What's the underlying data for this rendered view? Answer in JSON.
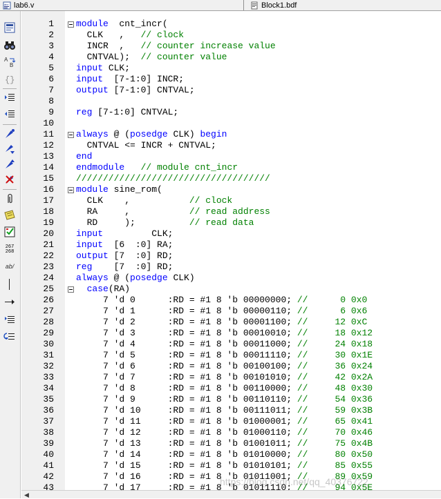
{
  "tabs": [
    {
      "label": "lab6.v",
      "icon": "verilog-file-icon"
    },
    {
      "label": "Block1.bdf",
      "icon": "block-diagram-file-icon"
    }
  ],
  "toolbar": [
    {
      "name": "insert-template-icon"
    },
    {
      "name": "find-binoculars-icon"
    },
    {
      "name": "find-replace-icon"
    },
    {
      "name": "braces-icon"
    },
    {
      "name": "indent-icon"
    },
    {
      "name": "unindent-icon"
    },
    {
      "name": "toggle-bookmark-icon"
    },
    {
      "name": "next-bookmark-icon"
    },
    {
      "name": "previous-bookmark-icon"
    },
    {
      "name": "clear-bookmarks-icon"
    },
    {
      "name": "paperclip-icon"
    },
    {
      "name": "comment-block-icon"
    },
    {
      "name": "check-syntax-icon"
    },
    {
      "name": "line-numbers-icon",
      "text": "267\n268"
    },
    {
      "name": "text-format-icon",
      "text": "ab/"
    },
    {
      "name": "cursor-line-icon"
    },
    {
      "name": "arrow-right-icon"
    },
    {
      "name": "list-indent-icon"
    },
    {
      "name": "undo-wrap-icon"
    }
  ],
  "lines": [
    {
      "n": "1",
      "fold": true,
      "seg": [
        [
          "kw",
          "module"
        ],
        [
          "",
          "  cnt_incr("
        ]
      ]
    },
    {
      "n": "2",
      "fold": false,
      "seg": [
        [
          "",
          "  CLK   ,   "
        ],
        [
          "cm",
          "// clock"
        ]
      ]
    },
    {
      "n": "3",
      "fold": false,
      "seg": [
        [
          "",
          "  INCR  ,   "
        ],
        [
          "cm",
          "// counter increase value"
        ]
      ]
    },
    {
      "n": "4",
      "fold": false,
      "seg": [
        [
          "",
          "  CNTVAL);  "
        ],
        [
          "cm",
          "// counter value"
        ]
      ]
    },
    {
      "n": "5",
      "fold": false,
      "seg": [
        [
          "kw",
          "input"
        ],
        [
          "",
          " CLK;"
        ]
      ]
    },
    {
      "n": "6",
      "fold": false,
      "seg": [
        [
          "kw",
          "input"
        ],
        [
          "",
          "  [7-1:0] INCR;"
        ]
      ]
    },
    {
      "n": "7",
      "fold": false,
      "seg": [
        [
          "kw",
          "output"
        ],
        [
          "",
          " [7-1:0] CNTVAL;"
        ]
      ]
    },
    {
      "n": "8",
      "fold": false,
      "seg": [
        [
          "",
          ""
        ]
      ]
    },
    {
      "n": "9",
      "fold": false,
      "seg": [
        [
          "kw",
          "reg"
        ],
        [
          "",
          " [7-1:0] CNTVAL;"
        ]
      ]
    },
    {
      "n": "10",
      "fold": false,
      "seg": [
        [
          "",
          ""
        ]
      ]
    },
    {
      "n": "11",
      "fold": true,
      "seg": [
        [
          "kw",
          "always"
        ],
        [
          "",
          " @ ("
        ],
        [
          "kw",
          "posedge"
        ],
        [
          "",
          " CLK) "
        ],
        [
          "kw",
          "begin"
        ]
      ]
    },
    {
      "n": "12",
      "fold": false,
      "seg": [
        [
          "",
          "  CNTVAL <= INCR + CNTVAL;"
        ]
      ]
    },
    {
      "n": "13",
      "fold": false,
      "seg": [
        [
          "kw",
          "end"
        ]
      ]
    },
    {
      "n": "14",
      "fold": false,
      "seg": [
        [
          "kw",
          "endmodule"
        ],
        [
          "",
          "   "
        ],
        [
          "cm",
          "// module cnt_incr"
        ]
      ]
    },
    {
      "n": "15",
      "fold": false,
      "seg": [
        [
          "cm",
          "////////////////////////////////////"
        ]
      ]
    },
    {
      "n": "16",
      "fold": true,
      "seg": [
        [
          "kw",
          "module"
        ],
        [
          "",
          " sine_rom("
        ]
      ]
    },
    {
      "n": "17",
      "fold": false,
      "seg": [
        [
          "",
          "  CLK    ,           "
        ],
        [
          "cm",
          "// clock"
        ]
      ]
    },
    {
      "n": "18",
      "fold": false,
      "seg": [
        [
          "",
          "  RA     ,           "
        ],
        [
          "cm",
          "// read address"
        ]
      ]
    },
    {
      "n": "19",
      "fold": false,
      "seg": [
        [
          "",
          "  RD     );          "
        ],
        [
          "cm",
          "// read data"
        ]
      ]
    },
    {
      "n": "20",
      "fold": false,
      "seg": [
        [
          "kw",
          "input"
        ],
        [
          "",
          "         CLK;"
        ]
      ]
    },
    {
      "n": "21",
      "fold": false,
      "seg": [
        [
          "kw",
          "input"
        ],
        [
          "",
          "  [6  :0] RA;"
        ]
      ]
    },
    {
      "n": "22",
      "fold": false,
      "seg": [
        [
          "kw",
          "output"
        ],
        [
          "",
          " [7  :0] RD;"
        ]
      ]
    },
    {
      "n": "23",
      "fold": false,
      "seg": [
        [
          "kw",
          "reg"
        ],
        [
          "",
          "    [7  :0] RD;"
        ]
      ]
    },
    {
      "n": "24",
      "fold": false,
      "seg": [
        [
          "kw",
          "always"
        ],
        [
          "",
          " @ ("
        ],
        [
          "kw",
          "posedge"
        ],
        [
          "",
          " CLK)"
        ]
      ]
    },
    {
      "n": "25",
      "fold": true,
      "seg": [
        [
          "",
          "  "
        ],
        [
          "kw",
          "case"
        ],
        [
          "",
          "(RA)"
        ]
      ]
    },
    {
      "n": "26",
      "fold": false,
      "seg": [
        [
          "",
          "     7 'd 0      :RD = #1 8 'b 00000000; "
        ],
        [
          "cm",
          "//      0 0x0"
        ]
      ]
    },
    {
      "n": "27",
      "fold": false,
      "seg": [
        [
          "",
          "     7 'd 1      :RD = #1 8 'b 00000110; "
        ],
        [
          "cm",
          "//      6 0x6"
        ]
      ]
    },
    {
      "n": "28",
      "fold": false,
      "seg": [
        [
          "",
          "     7 'd 2      :RD = #1 8 'b 00001100; "
        ],
        [
          "cm",
          "//     12 0xC"
        ]
      ]
    },
    {
      "n": "29",
      "fold": false,
      "seg": [
        [
          "",
          "     7 'd 3      :RD = #1 8 'b 00010010; "
        ],
        [
          "cm",
          "//     18 0x12"
        ]
      ]
    },
    {
      "n": "30",
      "fold": false,
      "seg": [
        [
          "",
          "     7 'd 4      :RD = #1 8 'b 00011000; "
        ],
        [
          "cm",
          "//     24 0x18"
        ]
      ]
    },
    {
      "n": "31",
      "fold": false,
      "seg": [
        [
          "",
          "     7 'd 5      :RD = #1 8 'b 00011110; "
        ],
        [
          "cm",
          "//     30 0x1E"
        ]
      ]
    },
    {
      "n": "32",
      "fold": false,
      "seg": [
        [
          "",
          "     7 'd 6      :RD = #1 8 'b 00100100; "
        ],
        [
          "cm",
          "//     36 0x24"
        ]
      ]
    },
    {
      "n": "33",
      "fold": false,
      "seg": [
        [
          "",
          "     7 'd 7      :RD = #1 8 'b 00101010; "
        ],
        [
          "cm",
          "//     42 0x2A"
        ]
      ]
    },
    {
      "n": "34",
      "fold": false,
      "seg": [
        [
          "",
          "     7 'd 8      :RD = #1 8 'b 00110000; "
        ],
        [
          "cm",
          "//     48 0x30"
        ]
      ]
    },
    {
      "n": "35",
      "fold": false,
      "seg": [
        [
          "",
          "     7 'd 9      :RD = #1 8 'b 00110110; "
        ],
        [
          "cm",
          "//     54 0x36"
        ]
      ]
    },
    {
      "n": "36",
      "fold": false,
      "seg": [
        [
          "",
          "     7 'd 10     :RD = #1 8 'b 00111011; "
        ],
        [
          "cm",
          "//     59 0x3B"
        ]
      ]
    },
    {
      "n": "37",
      "fold": false,
      "seg": [
        [
          "",
          "     7 'd 11     :RD = #1 8 'b 01000001; "
        ],
        [
          "cm",
          "//     65 0x41"
        ]
      ]
    },
    {
      "n": "38",
      "fold": false,
      "seg": [
        [
          "",
          "     7 'd 12     :RD = #1 8 'b 01000110; "
        ],
        [
          "cm",
          "//     70 0x46"
        ]
      ]
    },
    {
      "n": "39",
      "fold": false,
      "seg": [
        [
          "",
          "     7 'd 13     :RD = #1 8 'b 01001011; "
        ],
        [
          "cm",
          "//     75 0x4B"
        ]
      ]
    },
    {
      "n": "40",
      "fold": false,
      "seg": [
        [
          "",
          "     7 'd 14     :RD = #1 8 'b 01010000; "
        ],
        [
          "cm",
          "//     80 0x50"
        ]
      ]
    },
    {
      "n": "41",
      "fold": false,
      "seg": [
        [
          "",
          "     7 'd 15     :RD = #1 8 'b 01010101; "
        ],
        [
          "cm",
          "//     85 0x55"
        ]
      ]
    },
    {
      "n": "42",
      "fold": false,
      "seg": [
        [
          "",
          "     7 'd 16     :RD = #1 8 'b 01011001; "
        ],
        [
          "cm",
          "//     89 0x59"
        ]
      ]
    },
    {
      "n": "43",
      "fold": false,
      "seg": [
        [
          "",
          "     7 'd 17     :RD = #1 8 'b 01011110; "
        ],
        [
          "cm",
          "//     94 0x5E"
        ]
      ]
    }
  ],
  "watermark": "https://blog.csdn.net/qq_40376722",
  "colors": {
    "keyword": "#0000ff",
    "comment": "#008000",
    "gutter": "#f0f0f0"
  }
}
